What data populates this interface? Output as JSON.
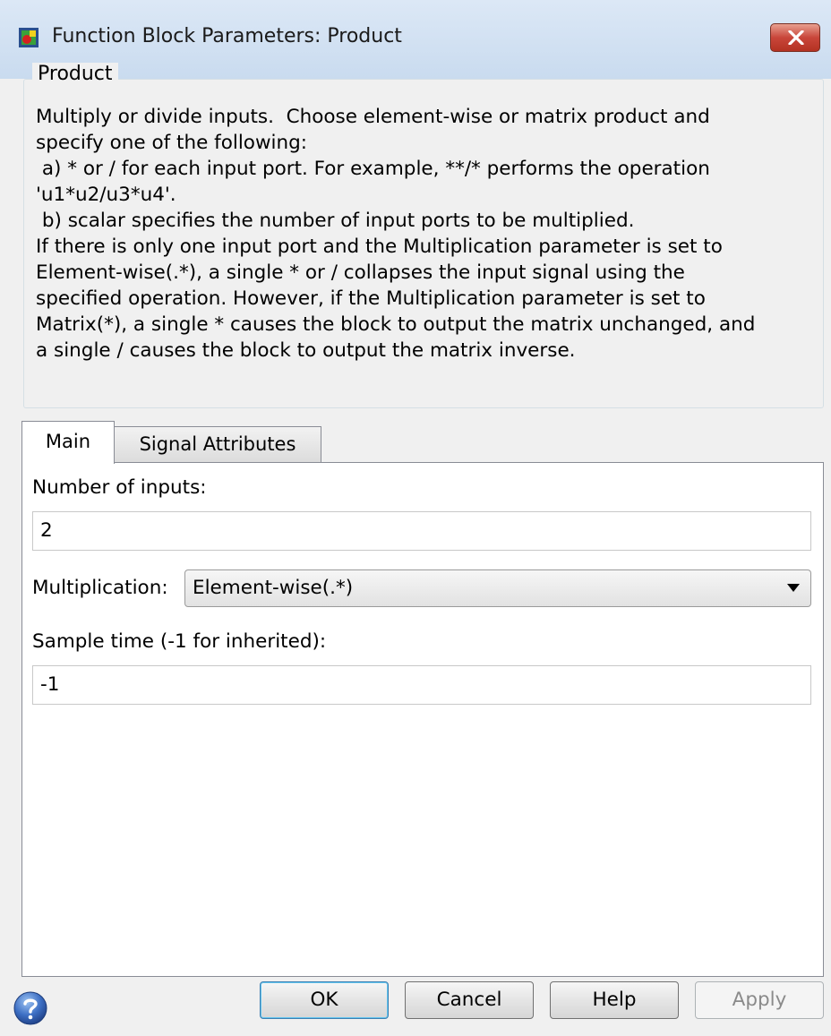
{
  "window": {
    "title": "Function Block Parameters: Product"
  },
  "group": {
    "legend": "Product",
    "description_lines": [
      "Multiply or divide inputs.  Choose element-wise or matrix product and",
      "specify one of the following:",
      " a) * or / for each input port. For example, **/* performs the operation",
      "'u1*u2/u3*u4'.",
      " b) scalar specifies the number of input ports to be multiplied.",
      "If there is only one input port and the Multiplication parameter is set to",
      "Element-wise(.*), a single * or / collapses the input signal using the",
      "specified operation. However, if the Multiplication parameter is set to",
      "Matrix(*), a single * causes the block to output the matrix unchanged, and",
      "a single / causes the block to output the matrix inverse."
    ]
  },
  "tabs": {
    "main": "Main",
    "signal_attributes": "Signal Attributes"
  },
  "main": {
    "number_of_inputs_label": "Number of inputs:",
    "number_of_inputs_value": "2",
    "multiplication_label": "Multiplication:",
    "multiplication_value": "Element-wise(.*)",
    "sample_time_label": "Sample time (-1 for inherited):",
    "sample_time_value": "-1"
  },
  "buttons": {
    "ok": "OK",
    "cancel": "Cancel",
    "help": "Help",
    "apply": "Apply"
  },
  "icons": {
    "app": "simulink-block-icon",
    "close": "close-icon",
    "help": "help-question-icon",
    "dropdown": "chevron-down-icon"
  },
  "colors": {
    "close_button": "#c9463a",
    "ok_focus": "#3c7fb1",
    "help_icon": "#3d6fc4"
  }
}
